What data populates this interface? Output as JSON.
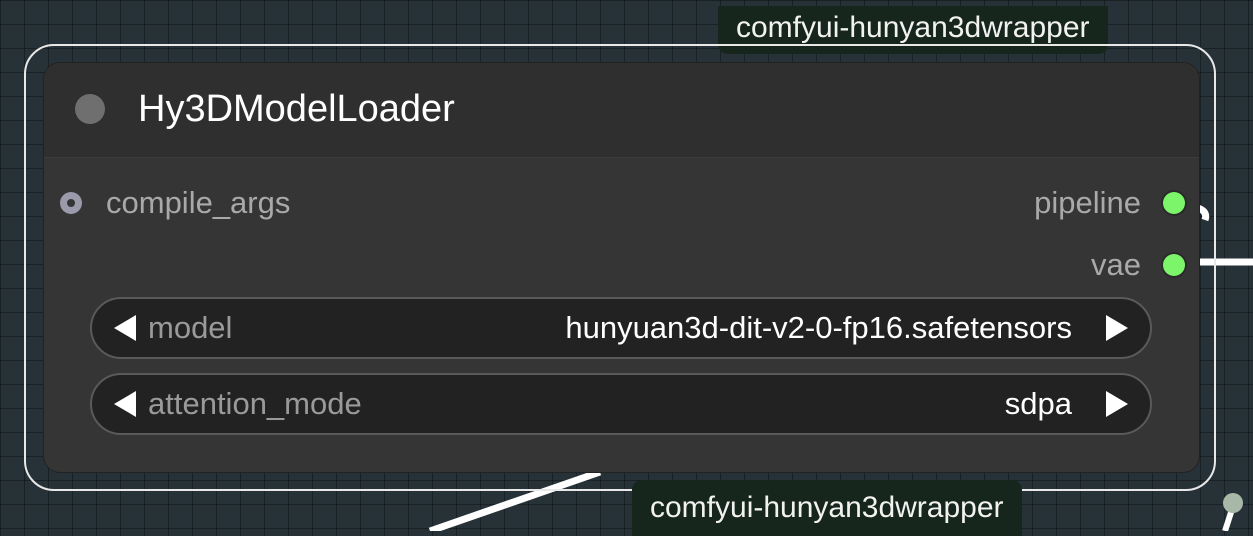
{
  "canvas": {
    "background_color": "#263238",
    "wire_color": "#ffffff",
    "link_dot_color": "#a8b8a8"
  },
  "badges": {
    "top_label": "comfyui-hunyan3dwrapper",
    "bottom_label": "comfyui-hunyan3dwrapper"
  },
  "node": {
    "title": "Hy3DModelLoader",
    "status_dot_color": "#6f6f6f",
    "inputs": [
      {
        "label": "compile_args",
        "icon": "input-slot-icon"
      }
    ],
    "outputs": [
      {
        "label": "pipeline",
        "color": "#7cf56a"
      },
      {
        "label": "vae",
        "color": "#7cf56a"
      }
    ],
    "widgets": [
      {
        "label": "model",
        "value": "hunyuan3d-dit-v2-0-fp16.safetensors"
      },
      {
        "label": "attention_mode",
        "value": "sdpa"
      }
    ]
  }
}
